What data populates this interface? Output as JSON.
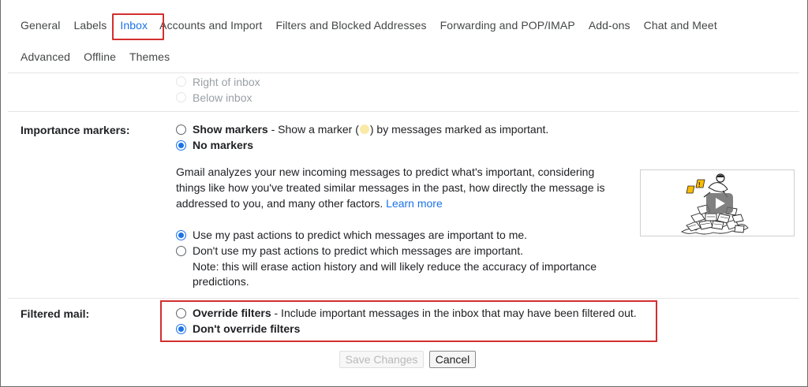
{
  "tabs": {
    "row1": [
      "General",
      "Labels",
      "Inbox",
      "Accounts and Import",
      "Filters and Blocked Addresses",
      "Forwarding and POP/IMAP",
      "Add-ons",
      "Chat and Meet"
    ],
    "row2": [
      "Advanced",
      "Offline",
      "Themes"
    ],
    "active": "Inbox"
  },
  "reading_pane": {
    "opt_right": "Right of inbox",
    "opt_below": "Below inbox"
  },
  "importance": {
    "label": "Importance markers:",
    "show_markers_label": "Show markers",
    "show_markers_desc_pre": " - Show a marker (",
    "show_markers_desc_post": ") by messages marked as important.",
    "no_markers_label": "No markers",
    "para_line1": "Gmail analyzes your new incoming messages to predict what's important, considering",
    "para_line2": "things like how you've treated similar messages in the past, how directly the message is",
    "para_line3": "addressed to you, and many other factors.",
    "learn_more": "Learn more",
    "use_past_actions": "Use my past actions to predict which messages are important to me.",
    "dont_use_past_actions": "Don't use my past actions to predict which messages are important.",
    "note_line1": "Note: this will erase action history and will likely reduce the accuracy of importance",
    "note_line2": "predictions."
  },
  "filtered": {
    "label": "Filtered mail:",
    "override_label": "Override filters",
    "override_desc": " - Include important messages in the inbox that may have been filtered out.",
    "dont_override_label": "Don't override filters"
  },
  "buttons": {
    "save": "Save Changes",
    "cancel": "Cancel"
  },
  "colors": {
    "accent": "#1a73e8",
    "highlight_box": "#d32f2f"
  }
}
